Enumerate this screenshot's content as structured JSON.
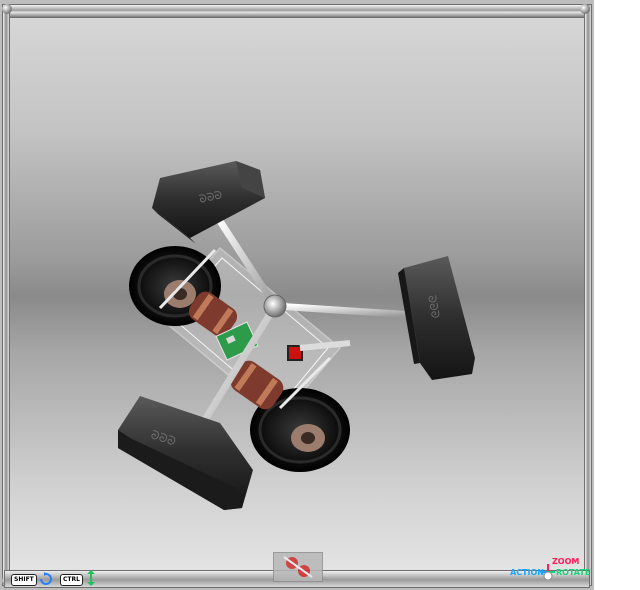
{
  "controls": {
    "shift_label": "SHIFT",
    "ctrl_label": "CTRL",
    "zoom_label": "ZOOM",
    "action_label": "ACTION",
    "rotate_label": "ROTATE"
  },
  "colors": {
    "zoom": "#ff1a5a",
    "action": "#1aa3ff",
    "rotate": "#19d27a"
  },
  "icons": [
    "rotate-icon",
    "up-down-arrow-icon",
    "navigation-cross-icon",
    "robot-thumbnail-icon"
  ]
}
